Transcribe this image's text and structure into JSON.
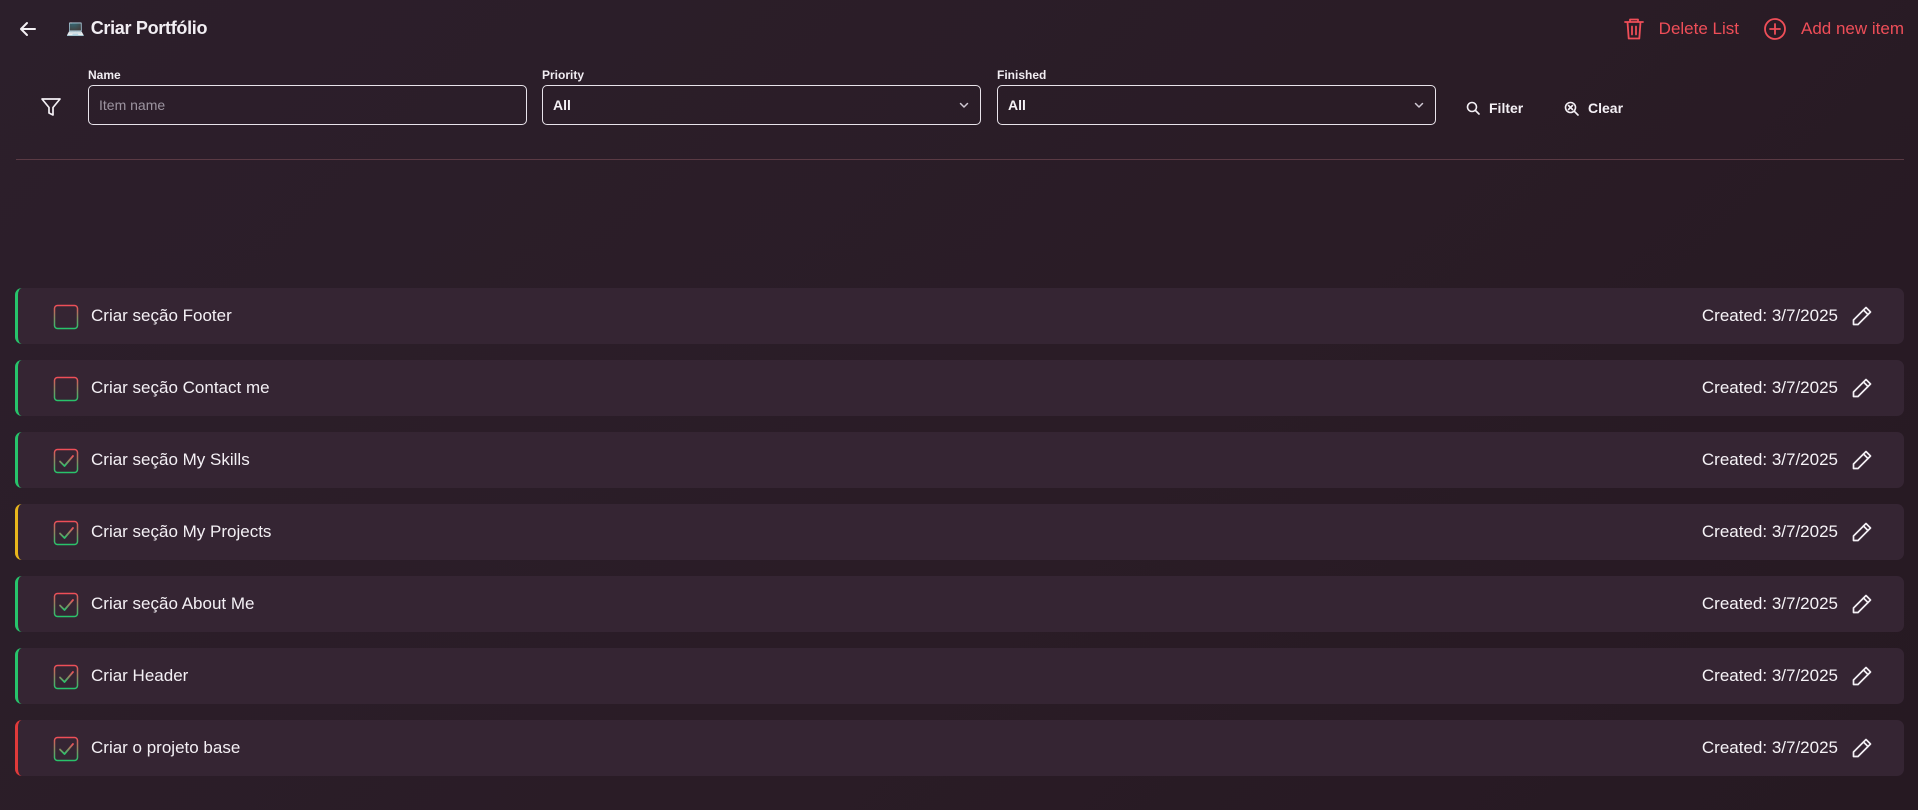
{
  "header": {
    "title_emoji": "💻",
    "title": "Criar Portfólio",
    "delete_label": "Delete List",
    "add_label": "Add new item"
  },
  "filters": {
    "name_label": "Name",
    "name_placeholder": "Item name",
    "name_value": "",
    "priority_label": "Priority",
    "priority_value": "All",
    "finished_label": "Finished",
    "finished_value": "All",
    "filter_button": "Filter",
    "clear_button": "Clear"
  },
  "items": [
    {
      "name": "Criar seção Footer",
      "created": "Created: 3/7/2025",
      "checked": false,
      "priority": "low",
      "priority_color": "#27c46b"
    },
    {
      "name": "Criar seção Contact me",
      "created": "Created: 3/7/2025",
      "checked": false,
      "priority": "low",
      "priority_color": "#27c46b"
    },
    {
      "name": "Criar seção My Skills",
      "created": "Created: 3/7/2025",
      "checked": true,
      "priority": "low",
      "priority_color": "#27c46b"
    },
    {
      "name": "Criar seção My Projects",
      "created": "Created: 3/7/2025",
      "checked": true,
      "priority": "medium",
      "priority_color": "#e8b61c"
    },
    {
      "name": "Criar seção About Me",
      "created": "Created: 3/7/2025",
      "checked": true,
      "priority": "low",
      "priority_color": "#27c46b"
    },
    {
      "name": "Criar Header",
      "created": "Created: 3/7/2025",
      "checked": true,
      "priority": "low",
      "priority_color": "#27c46b"
    },
    {
      "name": "Criar o projeto base",
      "created": "Created: 3/7/2025",
      "checked": true,
      "priority": "high",
      "priority_color": "#e03a3a"
    }
  ],
  "colors": {
    "accent": "#ef4e58",
    "background": "#2a1c26",
    "row_background": "#352533"
  },
  "icons": {
    "back": "arrow-left-icon",
    "delete": "trash-icon",
    "add": "plus-circle-icon",
    "filter": "funnel-icon",
    "search": "search-icon",
    "clear": "zoom-out-icon",
    "chevron": "chevron-down-icon",
    "edit": "pencil-icon"
  }
}
